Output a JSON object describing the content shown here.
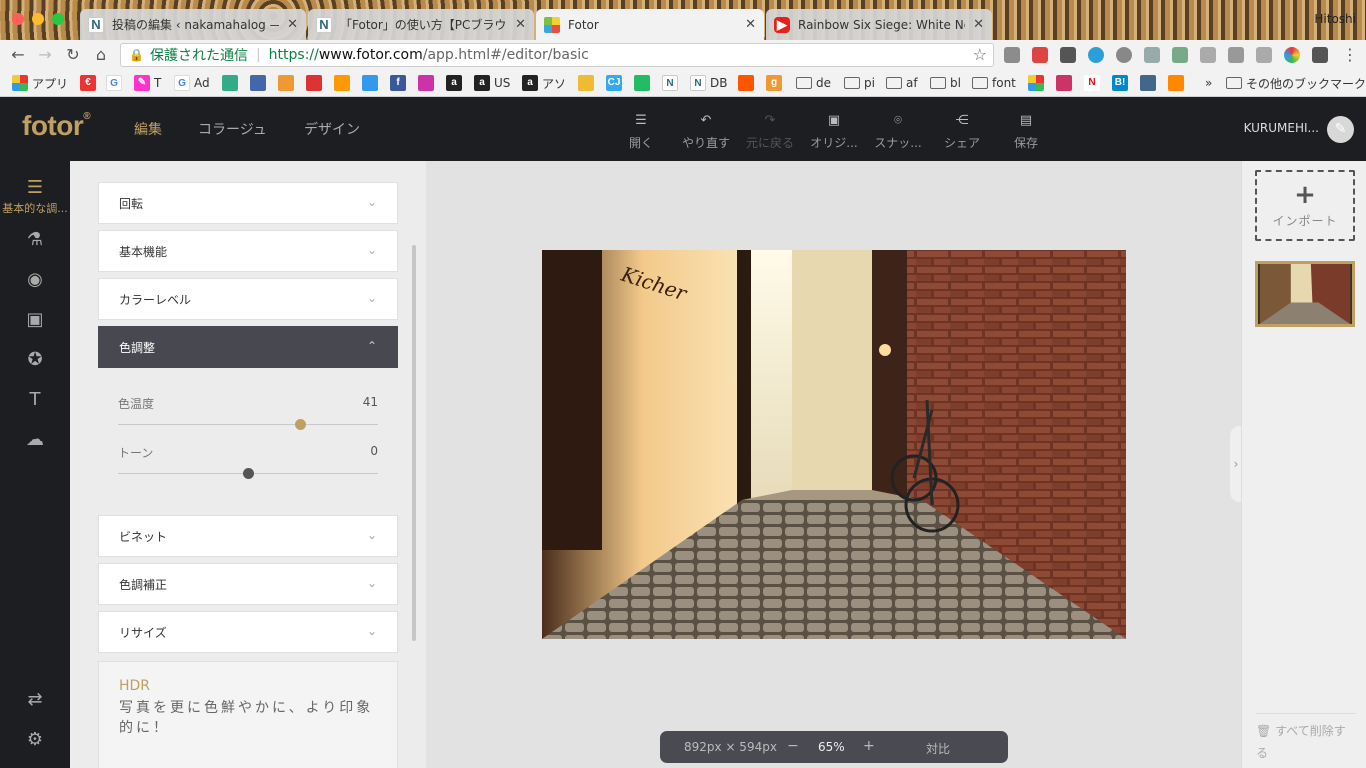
{
  "browser": {
    "tabs": [
      {
        "title": "投稿の編集 ‹ nakamahalog — W",
        "favicon": "N"
      },
      {
        "title": "「Fotor」の使い方【PCブラウザ",
        "favicon": "N"
      },
      {
        "title": "Fotor",
        "favicon": "fotor"
      },
      {
        "title": "Rainbow Six Siege: White Nois",
        "favicon": "youtube"
      }
    ],
    "tab_close": "✕",
    "profile_name": "Hitoshi",
    "secure_label": "保護された通信",
    "url_scheme": "https://",
    "url_host": "www.fotor.com",
    "url_path": "/app.html#/editor/basic",
    "bookmarks": [
      {
        "label": "アプリ",
        "icon": "apps-grid-icon"
      },
      {
        "label": "",
        "icon": "e-icon"
      },
      {
        "label": "",
        "icon": "google-icon"
      },
      {
        "label": "T",
        "icon": "pen-icon"
      },
      {
        "label": "Ad",
        "icon": "google-icon"
      },
      {
        "label": "US",
        "icon": "amazon-icon"
      },
      {
        "label": "アソ",
        "icon": "amazon-icon"
      },
      {
        "label": "DB",
        "icon": "n-icon"
      },
      {
        "label": "de",
        "icon": "folder-icon"
      },
      {
        "label": "pi",
        "icon": "folder-icon"
      },
      {
        "label": "af",
        "icon": "folder-icon"
      },
      {
        "label": "bl",
        "icon": "folder-icon"
      },
      {
        "label": "font",
        "icon": "folder-icon"
      },
      {
        "label": "その他のブックマーク",
        "icon": "folder-icon"
      }
    ],
    "more_bookmarks": "»"
  },
  "app": {
    "logo": "fotor",
    "logo_mark": "®",
    "nav": [
      "編集",
      "コラージュ",
      "デザイン"
    ],
    "toolbar": [
      {
        "label": "開く",
        "icon": "☰"
      },
      {
        "label": "やり直す",
        "icon": "↶"
      },
      {
        "label": "元に戻る",
        "icon": "↷"
      },
      {
        "label": "オリジ...",
        "icon": "▣"
      },
      {
        "label": "スナッ...",
        "icon": "⌾"
      },
      {
        "label": "シェア",
        "icon": "⋲"
      },
      {
        "label": "保存",
        "icon": "▤"
      }
    ],
    "account_name": "KURUMEHI...",
    "avatar_glyph": "✎"
  },
  "rail": {
    "active_label": "基本的な調...",
    "icons": [
      "adjust-sliders-icon",
      "flask-icon",
      "eye-icon",
      "frame-icon",
      "sticker-star-icon",
      "text-icon",
      "cloud-upload-icon",
      "swap-icon",
      "settings-icon"
    ]
  },
  "panel": {
    "sections_top": [
      "回転",
      "基本機能",
      "カラーレベル"
    ],
    "open_section": "色調整",
    "sliders": [
      {
        "label": "色温度",
        "value": 41,
        "position": 0.7,
        "color": "#c0a062"
      },
      {
        "label": "トーン",
        "value": 0,
        "position": 0.5,
        "color": "#555555"
      }
    ],
    "sections_bottom": [
      "ビネット",
      "色調補正",
      "リサイズ"
    ],
    "hdr_title": "HDR",
    "hdr_desc": "写真を更に色鮮やかに、より印象的に！"
  },
  "canvas": {
    "dimensions": "892px × 594px",
    "zoom_minus": "−",
    "zoom": "65%",
    "zoom_plus": "+",
    "compare": "対比",
    "photo_sign": "Kicher"
  },
  "right_strip": {
    "import_plus": "+",
    "import_label": "インポート",
    "delete_all": "すべて削除する"
  },
  "colors": {
    "accent": "#c0a062",
    "header_bg": "#1d1e22",
    "open_section_bg": "#474850"
  }
}
